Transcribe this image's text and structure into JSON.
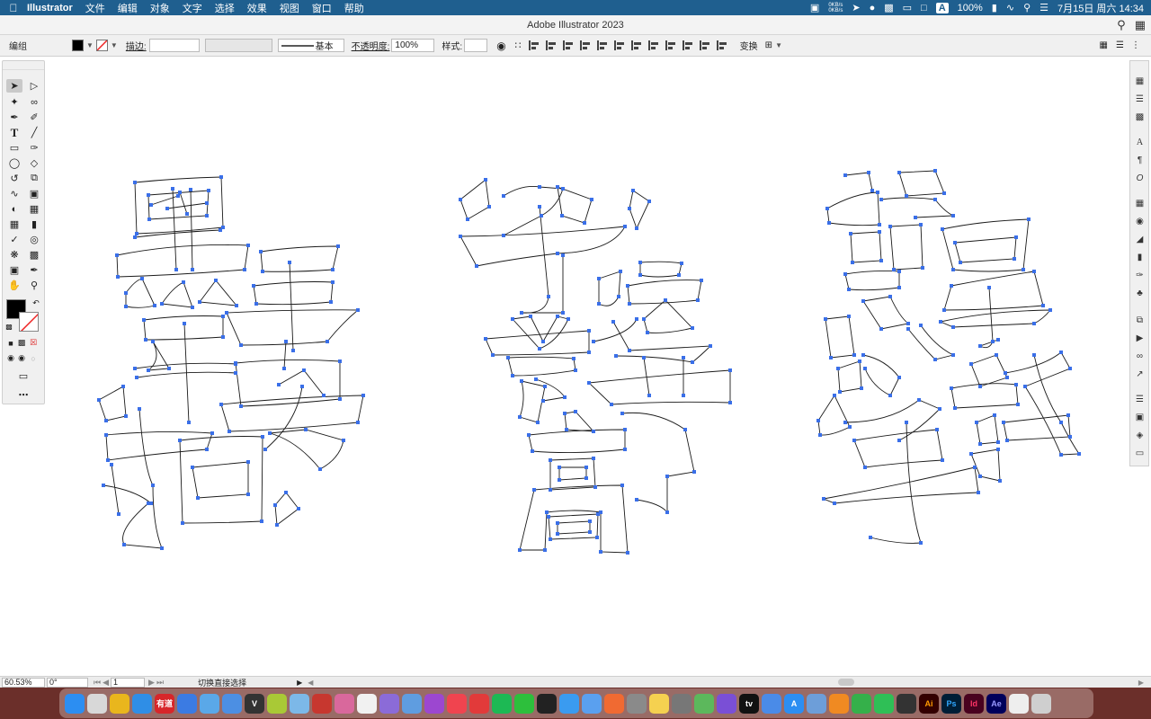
{
  "menubar": {
    "apple": "",
    "app_name": "Illustrator",
    "items": [
      "文件",
      "编辑",
      "对象",
      "文字",
      "选择",
      "效果",
      "视图",
      "窗口",
      "帮助"
    ],
    "net_up": "0KB/s",
    "net_down": "0KB/s",
    "input_method": "A",
    "battery": "100%",
    "datetime": "7月15日 周六  14:34"
  },
  "titlebar": {
    "title": "Adobe Illustrator 2023"
  },
  "controlbar": {
    "selection_label": "编组",
    "stroke_label": "描边:",
    "stroke_style": "基本",
    "opacity_label": "不透明度:",
    "opacity_value": "100%",
    "style_label": "样式:",
    "transform_label": "变换"
  },
  "statusbar": {
    "zoom": "60.53%",
    "rotation": "0°",
    "artboard_index": "1",
    "tool_status": "切换直接选择"
  },
  "colors": {
    "accent": "#1f5f8f",
    "anchor": "#3a6fe8",
    "path": "#1a1a1a"
  },
  "tools": [
    "selection-tool",
    "direct-selection-tool",
    "magic-wand-tool",
    "lasso-tool",
    "pen-tool",
    "curvature-tool",
    "type-tool",
    "line-tool",
    "rectangle-tool",
    "paintbrush-tool",
    "shaper-tool",
    "eraser-tool",
    "rotate-tool",
    "scale-tool",
    "warp-tool",
    "free-transform-tool",
    "shape-builder-tool",
    "perspective-tool",
    "mesh-tool",
    "gradient-tool",
    "eyedropper-tool",
    "blend-tool",
    "symbol-sprayer-tool",
    "graph-tool",
    "artboard-tool",
    "slice-tool",
    "hand-tool",
    "zoom-tool"
  ],
  "dock_apps": [
    {
      "name": "finder",
      "color": "#2c8ef2",
      "label": ""
    },
    {
      "name": "launchpad",
      "color": "#d8d8d8",
      "label": ""
    },
    {
      "name": "chrome",
      "color": "#e9b61d",
      "label": ""
    },
    {
      "name": "safari",
      "color": "#2f8ee6",
      "label": ""
    },
    {
      "name": "youdao",
      "color": "#d7262a",
      "label": "有道"
    },
    {
      "name": "app-blue",
      "color": "#3b7be3",
      "label": ""
    },
    {
      "name": "app-bird",
      "color": "#5aa8e8",
      "label": ""
    },
    {
      "name": "app-sticker",
      "color": "#4c8fe3",
      "label": ""
    },
    {
      "name": "app-v",
      "color": "#333333",
      "label": "V"
    },
    {
      "name": "app-green",
      "color": "#a9c936",
      "label": ""
    },
    {
      "name": "app-flower",
      "color": "#7cb8e8",
      "label": ""
    },
    {
      "name": "app-pdf",
      "color": "#c7372f",
      "label": ""
    },
    {
      "name": "app-pink",
      "color": "#d9689c",
      "label": ""
    },
    {
      "name": "app-doc",
      "color": "#f1f1f1",
      "label": ""
    },
    {
      "name": "app-downloads",
      "color": "#8b6bd8",
      "label": ""
    },
    {
      "name": "app-rainbow",
      "color": "#5f9de0",
      "label": ""
    },
    {
      "name": "podcasts",
      "color": "#9c47d0",
      "label": ""
    },
    {
      "name": "music",
      "color": "#f0444f",
      "label": ""
    },
    {
      "name": "netease",
      "color": "#e23a3a",
      "label": ""
    },
    {
      "name": "spotify",
      "color": "#1db954",
      "label": ""
    },
    {
      "name": "wechat",
      "color": "#2dbf3c",
      "label": ""
    },
    {
      "name": "qq",
      "color": "#222222",
      "label": ""
    },
    {
      "name": "app-chat",
      "color": "#3a9bf0",
      "label": ""
    },
    {
      "name": "app-paper",
      "color": "#5aa0ef",
      "label": ""
    },
    {
      "name": "app-orange",
      "color": "#f06a32",
      "label": ""
    },
    {
      "name": "settings",
      "color": "#8a8a8a",
      "label": ""
    },
    {
      "name": "notes",
      "color": "#f5d150",
      "label": ""
    },
    {
      "name": "calculator",
      "color": "#777777",
      "label": ""
    },
    {
      "name": "app-maps",
      "color": "#5cb85c",
      "label": ""
    },
    {
      "name": "app-star",
      "color": "#7a4fd6",
      "label": ""
    },
    {
      "name": "appletv",
      "color": "#111111",
      "label": "tv"
    },
    {
      "name": "app-cloud",
      "color": "#4a8be8",
      "label": ""
    },
    {
      "name": "appstore",
      "color": "#2c8ef2",
      "label": "A"
    },
    {
      "name": "app-preview",
      "color": "#6d9ed9",
      "label": ""
    },
    {
      "name": "pages",
      "color": "#f08a22",
      "label": ""
    },
    {
      "name": "numbers",
      "color": "#35b04a",
      "label": ""
    },
    {
      "name": "facetime",
      "color": "#2fbf56",
      "label": ""
    },
    {
      "name": "finalcut",
      "color": "#333333",
      "label": ""
    },
    {
      "name": "illustrator",
      "color": "#330000",
      "label": "Ai"
    },
    {
      "name": "photoshop",
      "color": "#001e36",
      "label": "Ps"
    },
    {
      "name": "indesign",
      "color": "#49021f",
      "label": "Id"
    },
    {
      "name": "aftereffects",
      "color": "#00005b",
      "label": "Ae"
    },
    {
      "name": "app-file",
      "color": "#eeeeee",
      "label": ""
    },
    {
      "name": "trash",
      "color": "#cfcfcf",
      "label": ""
    }
  ]
}
